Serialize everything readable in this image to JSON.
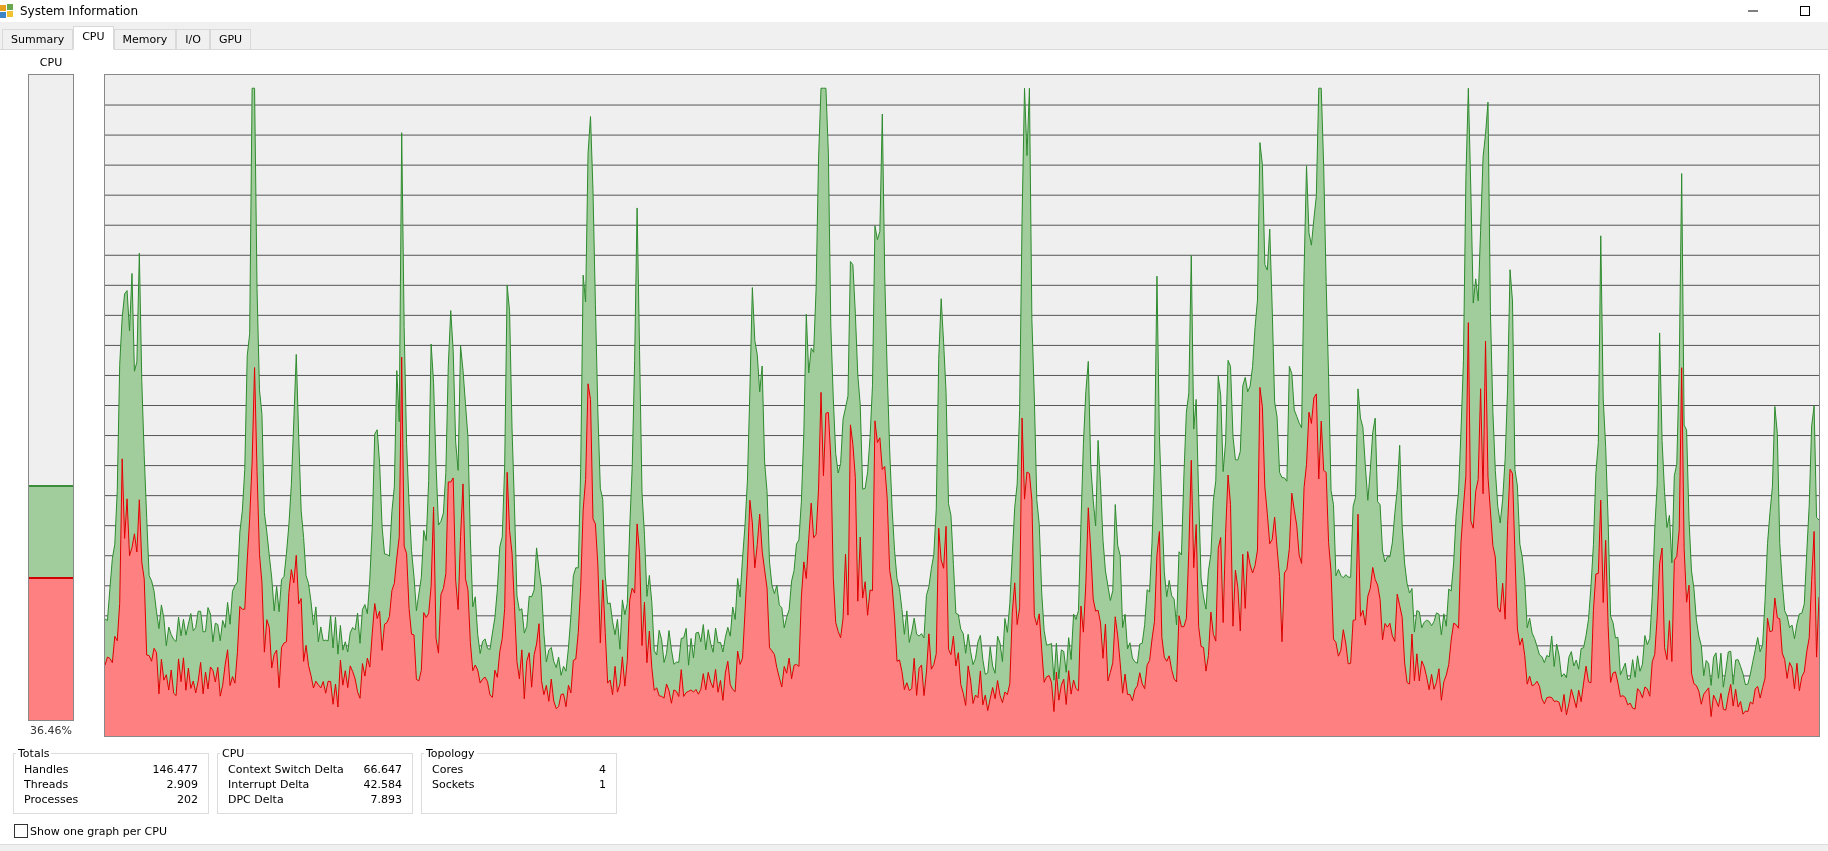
{
  "window": {
    "title": "System Information"
  },
  "tabs": [
    {
      "label": "Summary",
      "selected": false
    },
    {
      "label": "CPU",
      "selected": true
    },
    {
      "label": "Memory",
      "selected": false
    },
    {
      "label": "I/O",
      "selected": false
    },
    {
      "label": "GPU",
      "selected": false
    }
  ],
  "meter": {
    "label": "CPU",
    "reading": "36.46%",
    "segments": [
      {
        "kind": "total",
        "level": 0.3646
      },
      {
        "kind": "kernel",
        "level": 0.222
      }
    ]
  },
  "groups": [
    {
      "title": "Totals",
      "rows": [
        {
          "label": "Handles",
          "value": "146.477"
        },
        {
          "label": "Threads",
          "value": "2.909"
        },
        {
          "label": "Processes",
          "value": "202"
        }
      ]
    },
    {
      "title": "CPU",
      "rows": [
        {
          "label": "Context Switch Delta",
          "value": "66.647"
        },
        {
          "label": "Interrupt Delta",
          "value": "42.584"
        },
        {
          "label": "DPC Delta",
          "value": "7.893"
        }
      ]
    },
    {
      "title": "Topology",
      "rows": [
        {
          "label": "Cores",
          "value": "4"
        },
        {
          "label": "Sockets",
          "value": "1"
        }
      ]
    }
  ],
  "option": {
    "label": "Show one graph per CPU",
    "checked": false
  }
}
